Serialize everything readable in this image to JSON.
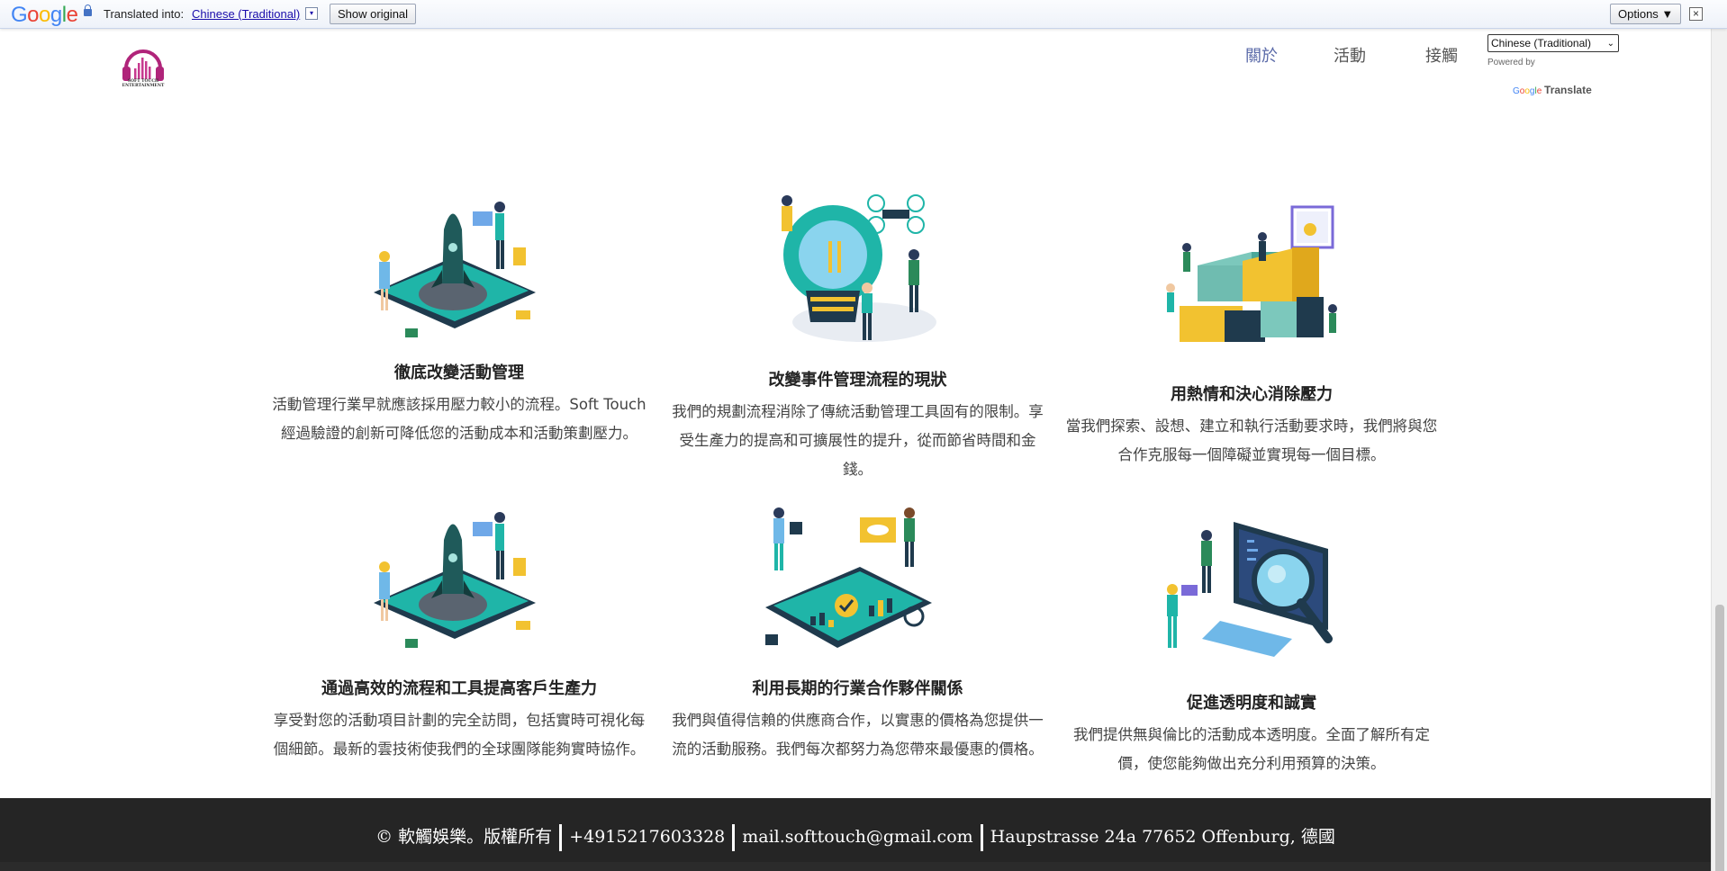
{
  "gbar": {
    "translated_into": "Translated into:",
    "language": "Chinese (Traditional)",
    "show_original": "Show original",
    "options": "Options ▼",
    "close": "×"
  },
  "header": {
    "logo_text": "SOFT TOUCH ENTERTAINMENT",
    "nav": [
      "關於",
      "活動",
      "接觸"
    ],
    "language_select": "Chinese (Traditional)",
    "powered_by": "Powered by",
    "google_translate": "Translate"
  },
  "features": [
    {
      "title": "徹底改變活動管理",
      "text": "活動管理行業早就應該採用壓力較小的流程。Soft Touch 經過驗證的創新可降低您的活動成本和活動策劃壓力。"
    },
    {
      "title": "改變事件管理流程的現狀",
      "text": "我們的規劃流程消除了傳統活動管理工具固有的限制。享受生產力的提高和可擴展性的提升，從而節省時間和金錢。"
    },
    {
      "title": "用熱情和決心消除壓力",
      "text": "當我們探索、設想、建立和執行活動要求時，我們將與您合作克服每一個障礙並實現每一個目標。"
    },
    {
      "title": "通過高效的流程和工具提高客戶生產力",
      "text": "享受對您的活動項目計劃的完全訪問，包括實時可視化每個細節。最新的雲技術使我們的全球團隊能夠實時協作。"
    },
    {
      "title": "利用長期的行業合作夥伴關係",
      "text": "我們與值得信賴的供應商合作，以實惠的價格為您提供一流的活動服務。我們每次都努力為您帶來最優惠的價格。"
    },
    {
      "title": "促進透明度和誠實",
      "text": "我們提供無與倫比的活動成本透明度。全面了解所有定價，使您能夠做出充分利用預算的決策。"
    }
  ],
  "footer": {
    "copyright": "© 軟觸娛樂。版權所有",
    "phone": "+4915217603328",
    "email": "mail.softtouch@gmail.com",
    "address": "Haupstrasse 24a 77652 Offenburg, 德國"
  },
  "colors": {
    "teal": "#1fb5a8",
    "navy": "#1f3a4d",
    "yellow": "#f2c230",
    "footer_bg": "#252525"
  }
}
